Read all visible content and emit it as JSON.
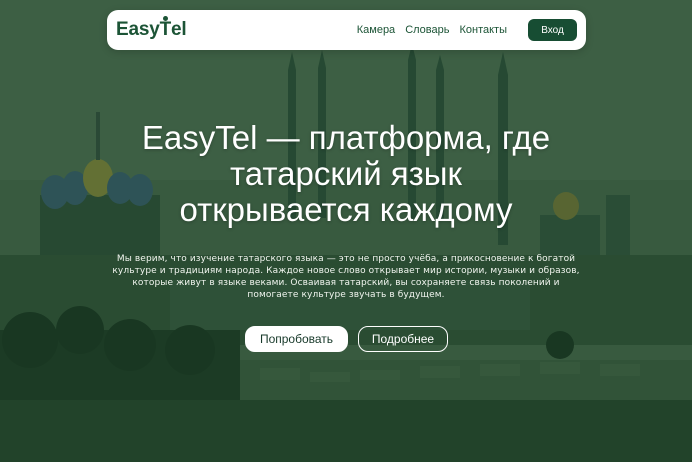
{
  "nav": {
    "logo_text_before": "Easy",
    "logo_text_t": "T",
    "logo_text_after": "el",
    "links": [
      "Камера",
      "Словарь",
      "Контакты"
    ],
    "login_label": "Вход"
  },
  "hero": {
    "title_lines": [
      "EasyTel — платформа, где",
      "татарский язык",
      "открывается каждому"
    ],
    "description_lines": [
      "Мы верим, что изучение татарского языка — это не просто учёба, а прикосновение к богатой",
      "культуре и традициям народа. Каждое новое слово открывает мир истории, музыки и образов,",
      "которые живут в языке веками. Осваивая татарский, вы сохраняете связь поколений и",
      "помогаете культуре звучать в будущем."
    ],
    "primary_button": "Попробовать",
    "secondary_button": "Подробнее"
  },
  "colors": {
    "brand_green": "#174d33",
    "overlay_green": "#24432c",
    "text_white": "#ffffff"
  },
  "icons": {
    "logo": "easytel-logo"
  }
}
